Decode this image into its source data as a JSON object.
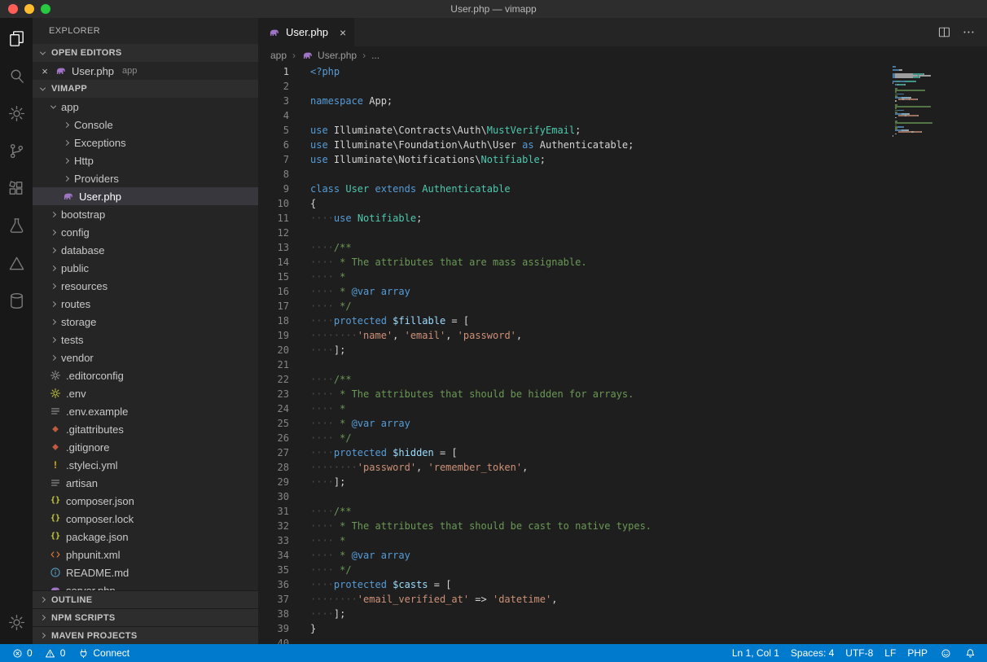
{
  "window": {
    "title": "User.php — vimapp"
  },
  "palette": {
    "status_bar_bg": "#007acc",
    "selection_bg": "#37373d",
    "php_icon_color": "#a074c4",
    "traffic_lights": {
      "close": "#ff5f57",
      "minimize": "#febc2e",
      "maximize": "#28c840"
    },
    "tokens": {
      "kw": "#569cd6",
      "ty": "#4ec9b0",
      "pl": "#d4d4d4",
      "str": "#ce9178",
      "cmt": "#6a9955",
      "var": "#9cdcfe",
      "ws": "#4b4b4b",
      "doc": "#569cd6"
    }
  },
  "activity_bar": {
    "top": [
      {
        "name": "explorer-icon",
        "active": true
      },
      {
        "name": "search-icon"
      },
      {
        "name": "settings-gear-icon"
      },
      {
        "name": "source-control-icon"
      },
      {
        "name": "extensions-icon"
      },
      {
        "name": "test-beaker-icon"
      },
      {
        "name": "triangle-icon"
      },
      {
        "name": "database-icon"
      }
    ],
    "bottom": [
      {
        "name": "manage-gear-icon"
      }
    ]
  },
  "sidebar": {
    "title": "EXPLORER",
    "open_editors": {
      "label": "OPEN EDITORS",
      "items": [
        {
          "name": "User.php",
          "detail": "app",
          "icon": "php"
        }
      ]
    },
    "project": {
      "label": "VIMAPP"
    },
    "tree": [
      {
        "label": "app",
        "kind": "folder",
        "depth": 0,
        "expanded": true
      },
      {
        "label": "Console",
        "kind": "folder",
        "depth": 1
      },
      {
        "label": "Exceptions",
        "kind": "folder",
        "depth": 1
      },
      {
        "label": "Http",
        "kind": "folder",
        "depth": 1
      },
      {
        "label": "Providers",
        "kind": "folder",
        "depth": 1
      },
      {
        "label": "User.php",
        "kind": "file",
        "icon": "php",
        "depth": 1,
        "selected": true
      },
      {
        "label": "bootstrap",
        "kind": "folder",
        "depth": 0
      },
      {
        "label": "config",
        "kind": "folder",
        "depth": 0
      },
      {
        "label": "database",
        "kind": "folder",
        "depth": 0
      },
      {
        "label": "public",
        "kind": "folder",
        "depth": 0
      },
      {
        "label": "resources",
        "kind": "folder",
        "depth": 0
      },
      {
        "label": "routes",
        "kind": "folder",
        "depth": 0
      },
      {
        "label": "storage",
        "kind": "folder",
        "depth": 0
      },
      {
        "label": "tests",
        "kind": "folder",
        "depth": 0
      },
      {
        "label": "vendor",
        "kind": "folder",
        "depth": 0
      },
      {
        "label": ".editorconfig",
        "kind": "file",
        "icon": "gear-grey",
        "depth": 0
      },
      {
        "label": ".env",
        "kind": "file",
        "icon": "gear-yellow",
        "depth": 0
      },
      {
        "label": ".env.example",
        "kind": "file",
        "icon": "list",
        "depth": 0
      },
      {
        "label": ".gitattributes",
        "kind": "file",
        "icon": "git",
        "depth": 0
      },
      {
        "label": ".gitignore",
        "kind": "file",
        "icon": "git",
        "depth": 0
      },
      {
        "label": ".styleci.yml",
        "kind": "file",
        "icon": "warn",
        "depth": 0
      },
      {
        "label": "artisan",
        "kind": "file",
        "icon": "list",
        "depth": 0
      },
      {
        "label": "composer.json",
        "kind": "file",
        "icon": "braces",
        "depth": 0
      },
      {
        "label": "composer.lock",
        "kind": "file",
        "icon": "braces",
        "depth": 0
      },
      {
        "label": "package.json",
        "kind": "file",
        "icon": "braces",
        "depth": 0
      },
      {
        "label": "phpunit.xml",
        "kind": "file",
        "icon": "xml",
        "depth": 0
      },
      {
        "label": "README.md",
        "kind": "file",
        "icon": "info",
        "depth": 0
      },
      {
        "label": "server.php",
        "kind": "file",
        "icon": "php",
        "depth": 0
      }
    ],
    "bottom_sections": [
      {
        "label": "OUTLINE"
      },
      {
        "label": "NPM SCRIPTS"
      },
      {
        "label": "MAVEN PROJECTS"
      }
    ]
  },
  "editor": {
    "tab": {
      "label": "User.php",
      "icon": "php"
    },
    "actions": [
      {
        "name": "split-editor-icon"
      },
      {
        "name": "more-actions-icon"
      }
    ],
    "breadcrumb": [
      {
        "label": "app"
      },
      {
        "label": "User.php",
        "icon": "php"
      },
      {
        "label": "..."
      }
    ],
    "gutter": {
      "first_line": 1,
      "last_line": 40
    },
    "lines": [
      [
        [
          "kw",
          "<?php"
        ]
      ],
      [],
      [
        [
          "kw",
          "namespace"
        ],
        [
          "pl",
          " App;"
        ]
      ],
      [],
      [
        [
          "kw",
          "use"
        ],
        [
          "pl",
          " Illuminate\\Contracts\\Auth\\"
        ],
        [
          "ty",
          "MustVerifyEmail"
        ],
        [
          "pl",
          ";"
        ]
      ],
      [
        [
          "kw",
          "use"
        ],
        [
          "pl",
          " Illuminate\\Foundation\\Auth\\User "
        ],
        [
          "kw",
          "as"
        ],
        [
          "pl",
          " Authenticatable;"
        ]
      ],
      [
        [
          "kw",
          "use"
        ],
        [
          "pl",
          " Illuminate\\Notifications\\"
        ],
        [
          "ty",
          "Notifiable"
        ],
        [
          "pl",
          ";"
        ]
      ],
      [],
      [
        [
          "kw",
          "class"
        ],
        [
          "ty",
          " User"
        ],
        [
          "kw",
          " extends"
        ],
        [
          "ty",
          " Authenticatable"
        ]
      ],
      [
        [
          "pl",
          "{"
        ]
      ],
      [
        [
          "ws",
          "····"
        ],
        [
          "kw",
          "use"
        ],
        [
          "pl",
          " "
        ],
        [
          "ty",
          "Notifiable"
        ],
        [
          "pl",
          ";"
        ]
      ],
      [],
      [
        [
          "ws",
          "····"
        ],
        [
          "cmt",
          "/**"
        ]
      ],
      [
        [
          "ws",
          "····"
        ],
        [
          "cmt",
          " * The attributes that are mass assignable."
        ]
      ],
      [
        [
          "ws",
          "····"
        ],
        [
          "cmt",
          " *"
        ]
      ],
      [
        [
          "ws",
          "····"
        ],
        [
          "cmt",
          " * "
        ],
        [
          "doc",
          "@var array"
        ]
      ],
      [
        [
          "ws",
          "····"
        ],
        [
          "cmt",
          " */"
        ]
      ],
      [
        [
          "ws",
          "····"
        ],
        [
          "kw",
          "protected"
        ],
        [
          "pl",
          " "
        ],
        [
          "var",
          "$fillable"
        ],
        [
          "pl",
          " = ["
        ]
      ],
      [
        [
          "ws",
          "········"
        ],
        [
          "str",
          "'name'"
        ],
        [
          "pl",
          ", "
        ],
        [
          "str",
          "'email'"
        ],
        [
          "pl",
          ", "
        ],
        [
          "str",
          "'password'"
        ],
        [
          "pl",
          ","
        ]
      ],
      [
        [
          "ws",
          "····"
        ],
        [
          "pl",
          "];"
        ]
      ],
      [],
      [
        [
          "ws",
          "····"
        ],
        [
          "cmt",
          "/**"
        ]
      ],
      [
        [
          "ws",
          "····"
        ],
        [
          "cmt",
          " * The attributes that should be hidden for arrays."
        ]
      ],
      [
        [
          "ws",
          "····"
        ],
        [
          "cmt",
          " *"
        ]
      ],
      [
        [
          "ws",
          "····"
        ],
        [
          "cmt",
          " * "
        ],
        [
          "doc",
          "@var array"
        ]
      ],
      [
        [
          "ws",
          "····"
        ],
        [
          "cmt",
          " */"
        ]
      ],
      [
        [
          "ws",
          "····"
        ],
        [
          "kw",
          "protected"
        ],
        [
          "pl",
          " "
        ],
        [
          "var",
          "$hidden"
        ],
        [
          "pl",
          " = ["
        ]
      ],
      [
        [
          "ws",
          "········"
        ],
        [
          "str",
          "'password'"
        ],
        [
          "pl",
          ", "
        ],
        [
          "str",
          "'remember_token'"
        ],
        [
          "pl",
          ","
        ]
      ],
      [
        [
          "ws",
          "····"
        ],
        [
          "pl",
          "];"
        ]
      ],
      [],
      [
        [
          "ws",
          "····"
        ],
        [
          "cmt",
          "/**"
        ]
      ],
      [
        [
          "ws",
          "····"
        ],
        [
          "cmt",
          " * The attributes that should be cast to native types."
        ]
      ],
      [
        [
          "ws",
          "····"
        ],
        [
          "cmt",
          " *"
        ]
      ],
      [
        [
          "ws",
          "····"
        ],
        [
          "cmt",
          " * "
        ],
        [
          "doc",
          "@var array"
        ]
      ],
      [
        [
          "ws",
          "····"
        ],
        [
          "cmt",
          " */"
        ]
      ],
      [
        [
          "ws",
          "····"
        ],
        [
          "kw",
          "protected"
        ],
        [
          "pl",
          " "
        ],
        [
          "var",
          "$casts"
        ],
        [
          "pl",
          " = ["
        ]
      ],
      [
        [
          "ws",
          "········"
        ],
        [
          "str",
          "'email_verified_at'"
        ],
        [
          "pl",
          " => "
        ],
        [
          "str",
          "'datetime'"
        ],
        [
          "pl",
          ","
        ]
      ],
      [
        [
          "ws",
          "····"
        ],
        [
          "pl",
          "];"
        ]
      ],
      [
        [
          "pl",
          "}"
        ]
      ],
      []
    ]
  },
  "status_bar": {
    "left": [
      {
        "name": "status-errors",
        "icon": "error-icon",
        "label": "0"
      },
      {
        "name": "status-warnings",
        "icon": "warning-icon",
        "label": "0"
      },
      {
        "name": "status-connect",
        "icon": "connect-icon",
        "label": "Connect"
      }
    ],
    "right": [
      {
        "name": "status-cursor-position",
        "label": "Ln 1, Col 1"
      },
      {
        "name": "status-indentation",
        "label": "Spaces: 4"
      },
      {
        "name": "status-encoding",
        "label": "UTF-8"
      },
      {
        "name": "status-eol",
        "label": "LF"
      },
      {
        "name": "status-language-mode",
        "label": "PHP"
      },
      {
        "name": "status-feedback",
        "icon": "feedback-icon"
      },
      {
        "name": "status-notifications",
        "icon": "bell-icon"
      }
    ]
  }
}
